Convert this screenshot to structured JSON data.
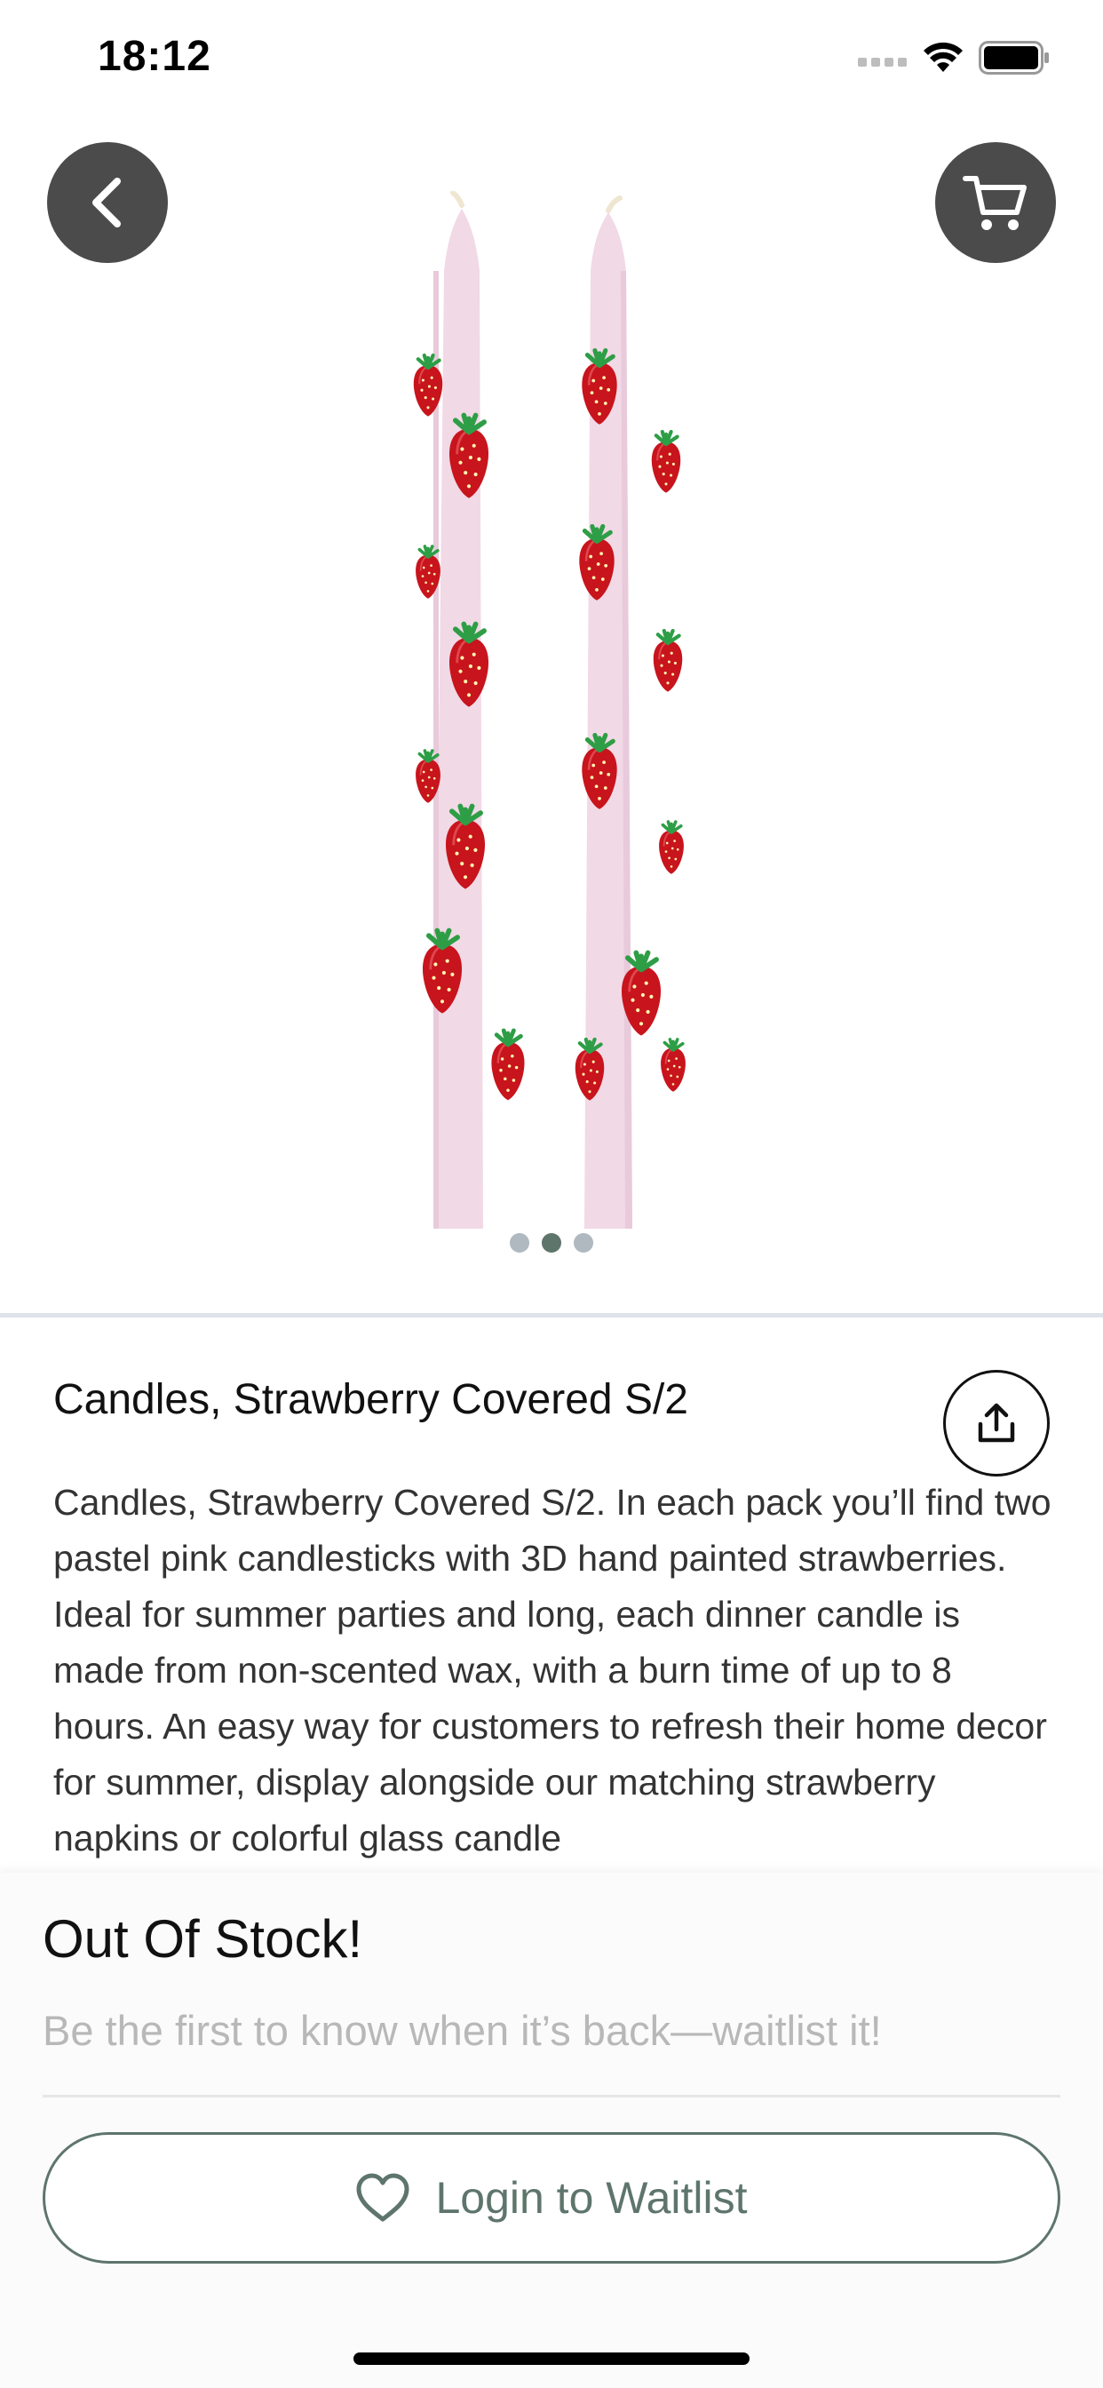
{
  "status_bar": {
    "time": "18:12"
  },
  "colors": {
    "accent": "#5e756c",
    "button_dark": "#4b4b4b",
    "muted_text": "#b8b8b8",
    "candle_pink": "#f1d9e6",
    "strawberry_red": "#c8141c"
  },
  "icons": {
    "back": "chevron-left-icon",
    "cart": "cart-icon",
    "share": "share-icon",
    "heart": "heart-outline-icon"
  },
  "gallery": {
    "dots": 3,
    "active_index": 2
  },
  "product": {
    "title": "Candles, Strawberry Covered S/2",
    "description": "Candles, Strawberry Covered S/2. In each pack you’ll find two pastel pink candlesticks with 3D hand painted strawberries. Ideal for summer parties and long, each dinner candle is made from non-scented wax, with a burn time of up to 8 hours. An easy way for customers to refresh their home decor for summer, display alongside our matching strawberry napkins or colorful glass candle"
  },
  "stock": {
    "title": "Out Of Stock!",
    "subtitle": "Be the first to know when it’s back—waitlist it!",
    "button_label": "Login to Waitlist"
  }
}
